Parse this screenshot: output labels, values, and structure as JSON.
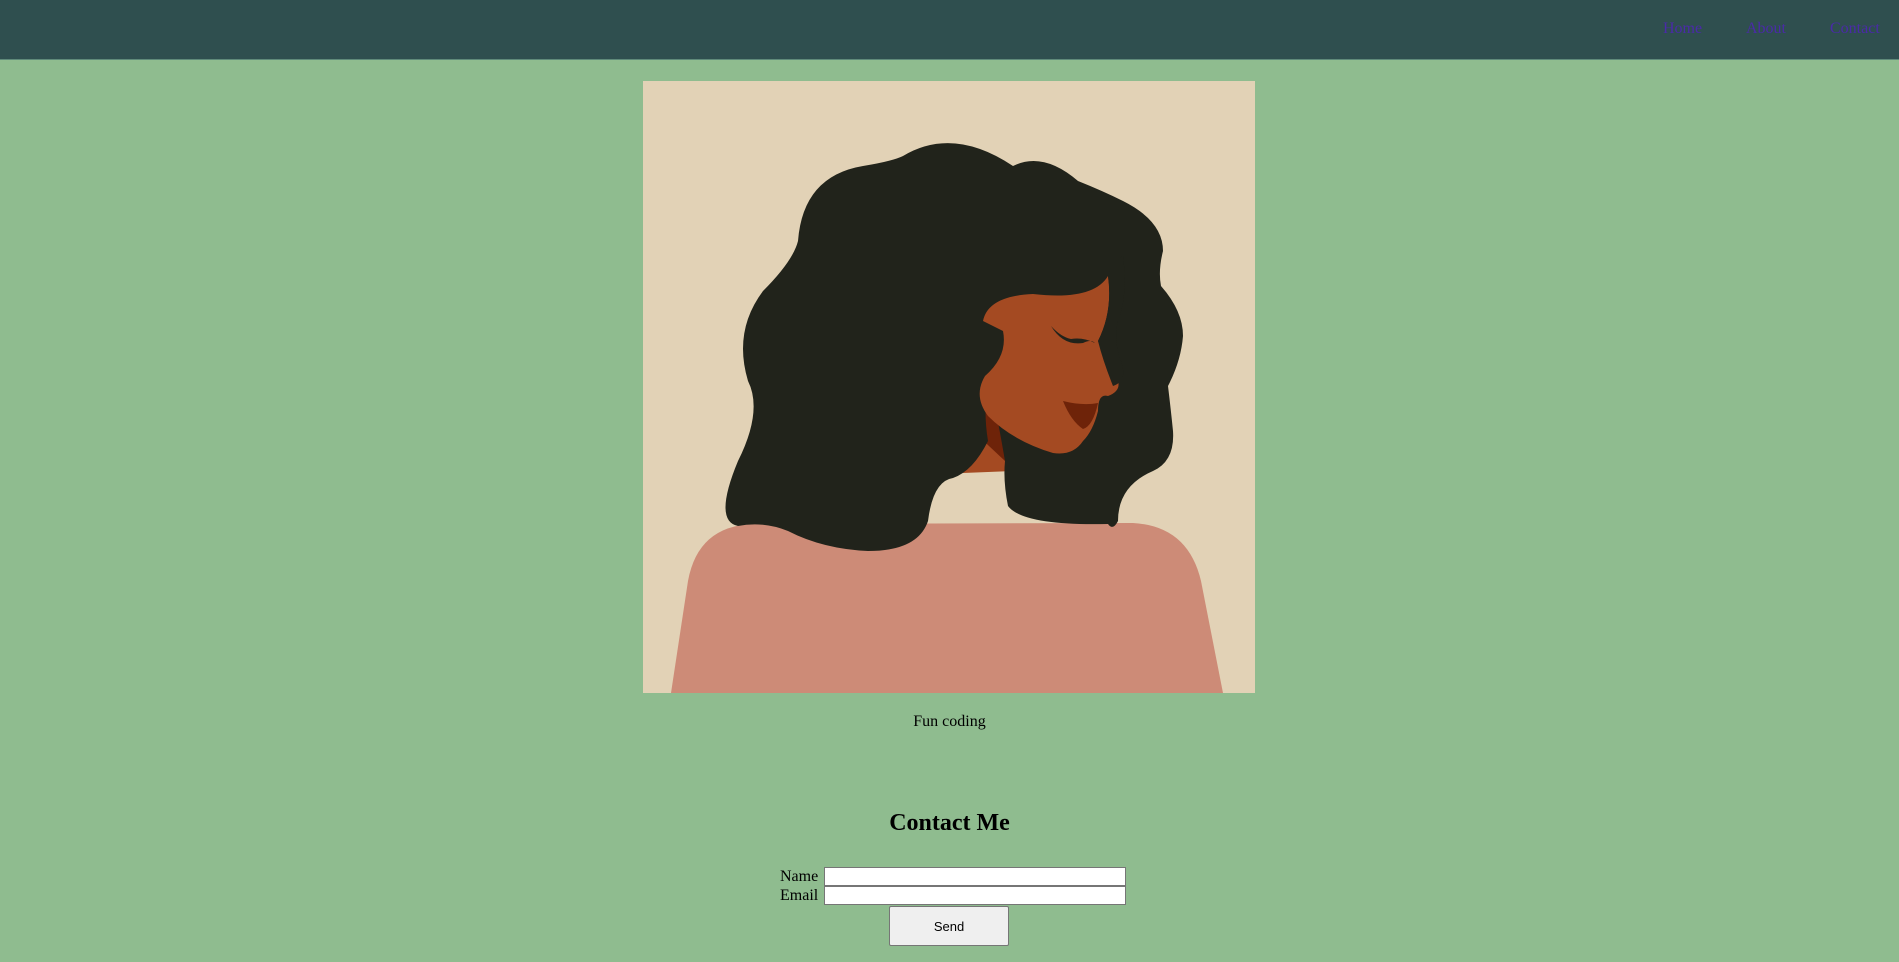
{
  "nav": {
    "items": [
      {
        "label": "Home"
      },
      {
        "label": "About"
      },
      {
        "label": "Contact"
      }
    ]
  },
  "hero": {
    "caption": "Fun coding",
    "colors": {
      "background": "#e2d2b6",
      "hair": "#21231b",
      "skin": "#a44a22",
      "shadow": "#6e2309",
      "shoulders": "#cd8b77"
    }
  },
  "contact": {
    "heading": "Contact Me",
    "name_label": "Name",
    "email_label": "Email",
    "name_value": "",
    "email_value": "",
    "send_label": "Send"
  },
  "colors": {
    "page_background": "#8fbc8f",
    "navbar_background": "#2f4f4f",
    "link": "#4a2aa8"
  }
}
